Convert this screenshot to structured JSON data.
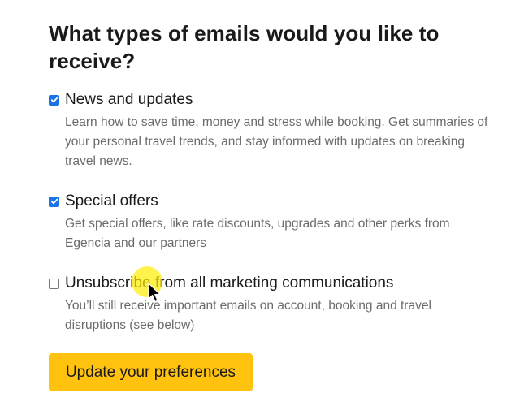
{
  "heading": "What types of emails would you like to receive?",
  "options": [
    {
      "label": "News and updates",
      "checked": true,
      "description": "Learn how to save time, money and stress while booking. Get summaries of your personal travel trends, and stay informed with updates on breaking travel news."
    },
    {
      "label": "Special offers",
      "checked": true,
      "description": "Get special offers, like rate discounts, upgrades and other perks from Egencia and our partners"
    },
    {
      "label": "Unsubscribe from all marketing communications",
      "checked": false,
      "description": "You’ll still receive important emails on account, booking and travel disruptions (see below)"
    }
  ],
  "button": {
    "label": "Update your preferences"
  },
  "colors": {
    "button_background": "#ffc20e",
    "checkbox_checked": "#1a73e8",
    "description_text": "#6b6b6b",
    "cursor_highlight": "#ffec00"
  },
  "icons": {
    "checkbox_check": "check-icon",
    "pointer": "mouse-pointer-icon"
  }
}
